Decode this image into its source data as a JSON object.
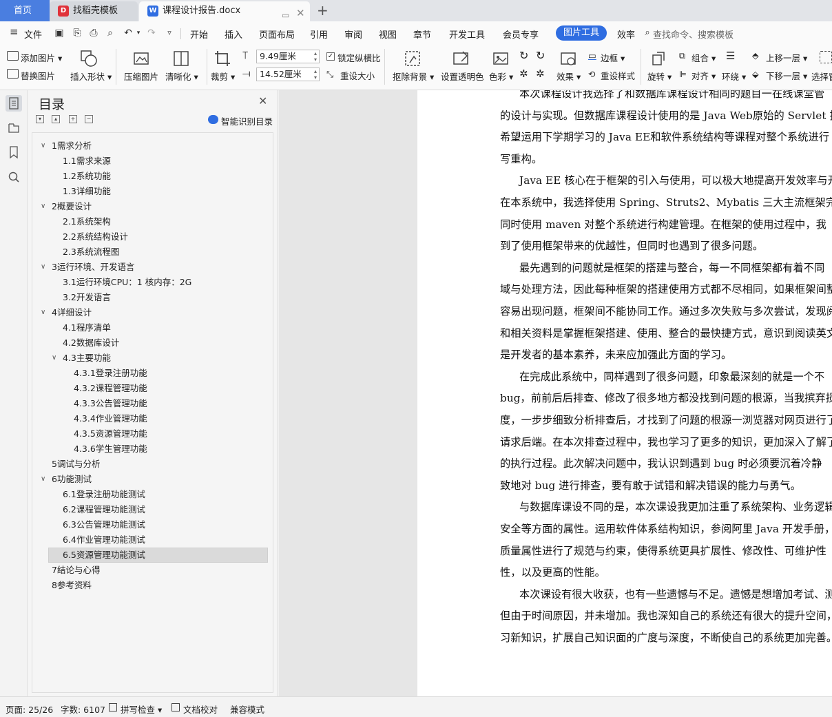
{
  "tabs": {
    "home": "首页",
    "templates": "找稻壳模板",
    "document": "课程设计报告.docx",
    "new_tab": "+"
  },
  "menu": {
    "file": "文件",
    "items": [
      "开始",
      "插入",
      "页面布局",
      "引用",
      "审阅",
      "视图",
      "章节",
      "开发工具",
      "会员专享"
    ],
    "active": "图片工具",
    "after_active": "效率",
    "search": "查找命令、搜索模板"
  },
  "ribbon": {
    "add_picture": "添加图片",
    "replace_picture": "替换图片",
    "insert_shape": "插入形状",
    "compress": "压缩图片",
    "sharpen": "清晰化",
    "crop": "裁剪",
    "width": "9.49厘米",
    "height": "14.52厘米",
    "lock_ratio": "锁定纵横比",
    "reset_size": "重设大小",
    "remove_bg": "抠除背景",
    "set_transparent": "设置透明色",
    "color": "色彩",
    "effects": "效果",
    "border": "边框",
    "reset_style": "重设样式",
    "rotate": "旋转",
    "group": "组合",
    "align": "对齐",
    "wrap": "环绕",
    "bring_forward": "上移一层",
    "send_backward": "下移一层",
    "select": "选择窗"
  },
  "toc": {
    "title": "目录",
    "smart": "智能识别目录",
    "items": [
      {
        "label": "1需求分析",
        "level": 1,
        "expand": true
      },
      {
        "label": "1.1需求来源",
        "level": 2
      },
      {
        "label": "1.2系统功能",
        "level": 2
      },
      {
        "label": "1.3详细功能",
        "level": 2
      },
      {
        "label": "2概要设计",
        "level": 1,
        "expand": true
      },
      {
        "label": "2.1系统架构",
        "level": 2
      },
      {
        "label": "2.2系统结构设计",
        "level": 2
      },
      {
        "label": "2.3系统流程图",
        "level": 2
      },
      {
        "label": "3运行环境、开发语言",
        "level": 1,
        "expand": true
      },
      {
        "label": "3.1运行环境CPU：1 核内存：2G",
        "level": 2
      },
      {
        "label": "3.2开发语言",
        "level": 2
      },
      {
        "label": "4详细设计",
        "level": 1,
        "expand": true
      },
      {
        "label": "4.1程序清单",
        "level": 2
      },
      {
        "label": "4.2数据库设计",
        "level": 2
      },
      {
        "label": "4.3主要功能",
        "level": 2,
        "expand": true
      },
      {
        "label": "4.3.1登录注册功能",
        "level": 3
      },
      {
        "label": "4.3.2课程管理功能",
        "level": 3
      },
      {
        "label": "4.3.3公告管理功能",
        "level": 3
      },
      {
        "label": "4.3.4作业管理功能",
        "level": 3
      },
      {
        "label": "4.3.5资源管理功能",
        "level": 3
      },
      {
        "label": "4.3.6学生管理功能",
        "level": 3
      },
      {
        "label": "5调试与分析",
        "level": 1
      },
      {
        "label": "6功能测试",
        "level": 1,
        "expand": true
      },
      {
        "label": "6.1登录注册功能测试",
        "level": 2
      },
      {
        "label": "6.2课程管理功能测试",
        "level": 2
      },
      {
        "label": "6.3公告管理功能测试",
        "level": 2
      },
      {
        "label": "6.4作业管理功能测试",
        "level": 2
      },
      {
        "label": "6.5资源管理功能测试",
        "level": 2,
        "selected": true
      },
      {
        "label": "7结论与心得",
        "level": 1
      },
      {
        "label": "8参考资料",
        "level": 1
      }
    ]
  },
  "document": {
    "lines": [
      "本次课程设计我选择了和数据库课程设计相同的题目一在线课堂管",
      "的设计与实现。但数据库课程设计使用的是 Java Web原始的 Servlet 技",
      "希望运用下学期学习的 Java EE和软件系统结构等课程对整个系统进行",
      "写重构。",
      "Java EE 核心在于框架的引入与使用，可以极大地提高开发效率与开",
      "在本系统中，我选择使用 Spring、Struts2、Mybatis 三大主流框架完成系",
      "同时使用 maven 对整个系统进行构建管理。在框架的使用过程中，我",
      "到了使用框架带来的优越性，但同时也遇到了很多问题。",
      "最先遇到的问题就是框架的搭建与整合，每一不同框架都有着不同",
      "域与处理方法，因此每种框架的搭建使用方式都不尽相同，如果框架间整合",
      "容易出现问题，框架间不能协同工作。通过多次失败与多次尝试，发现阅读",
      "和相关资料是掌握框架搭建、使用、整合的最快捷方式，意识到阅读英文文",
      "是开发者的基本素养，未来应加强此方面的学习。",
      "在完成此系统中，同样遇到了很多问题，印象最深刻的就是一个不",
      "bug，前前后后排查、修改了很多地方都没找到问题的根源，当我摈弃损",
      "度，一步步细致分析排查后，才找到了问题的根源一浏览器对网页进行了",
      "请求后端。在本次排查过程中，我也学习了更多的知识，更加深入了解了",
      "的执行过程。此次解决问题中，我认识到遇到 bug 时必须要沉着冷静",
      "致地对 bug 进行排查，要有敢于试错和解决错误的能力与勇气。",
      "与数据库课设不同的是，本次课设我更加注重了系统架构、业务逻辑",
      "安全等方面的属性。运用软件体系结构知识，参阅阿里 Java 开发手册，",
      "质量属性进行了规范与约束，使得系统更具扩展性、修改性、可维护性",
      "性，以及更高的性能。",
      "本次课设有很大收获，也有一些遗憾与不足。遗憾是想增加考试、测",
      "但由于时间原因，并未增加。我也深知自己的系统还有很大的提升空间，",
      "习新知识，扩展自己知识面的广度与深度，不断使自己的系统更加完善。"
    ]
  },
  "status": {
    "page": "页面: 25/26",
    "words": "字数: 6107",
    "spell": "拼写检查",
    "proof": "文档校对",
    "compat": "兼容模式"
  }
}
